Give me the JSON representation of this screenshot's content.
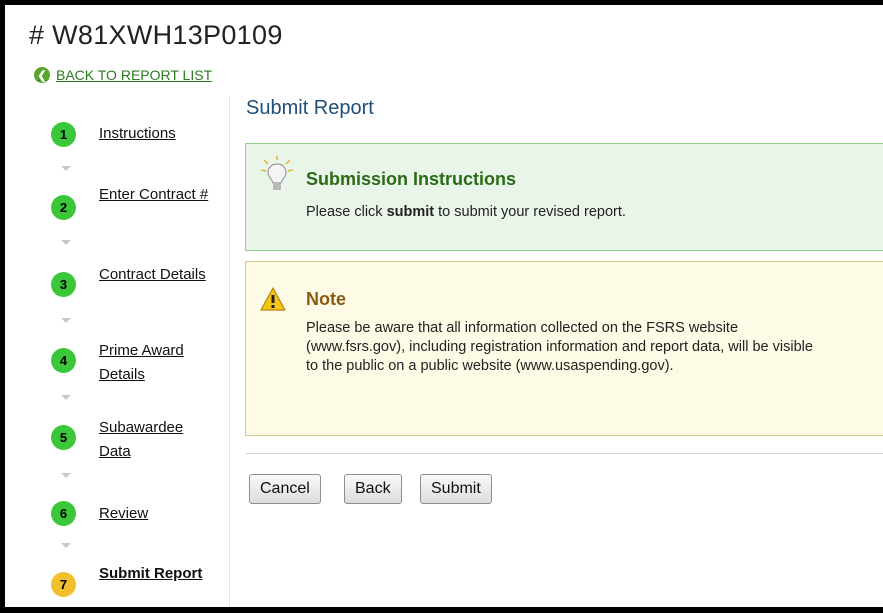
{
  "header": {
    "title": "# W81XWH13P0109",
    "back_link": "BACK TO REPORT LIST"
  },
  "steps": [
    {
      "number": "1",
      "label": "Instructions"
    },
    {
      "number": "2",
      "label": "Enter Contract #"
    },
    {
      "number": "3",
      "label": "Contract Details"
    },
    {
      "number": "4",
      "label": "Prime Award Details"
    },
    {
      "number": "5",
      "label": "Subawardee Data"
    },
    {
      "number": "6",
      "label": "Review"
    },
    {
      "number": "7",
      "label": "Submit Report",
      "current": true
    }
  ],
  "main": {
    "heading": "Submit Report",
    "instructions": {
      "title": "Submission Instructions",
      "text_before": "Please click ",
      "text_bold": "submit",
      "text_after": " to submit your revised report."
    },
    "note": {
      "title": "Note",
      "text": "Please be aware that all information collected on the FSRS website (www.fsrs.gov), including registration information and report data, will be visible to the public on a public website (www.usaspending.gov)."
    },
    "buttons": {
      "cancel": "Cancel",
      "back": "Back",
      "submit": "Submit"
    }
  },
  "colors": {
    "step_complete": "#3cc63a",
    "step_current": "#f2c02e",
    "link": "#2a7b1f"
  }
}
